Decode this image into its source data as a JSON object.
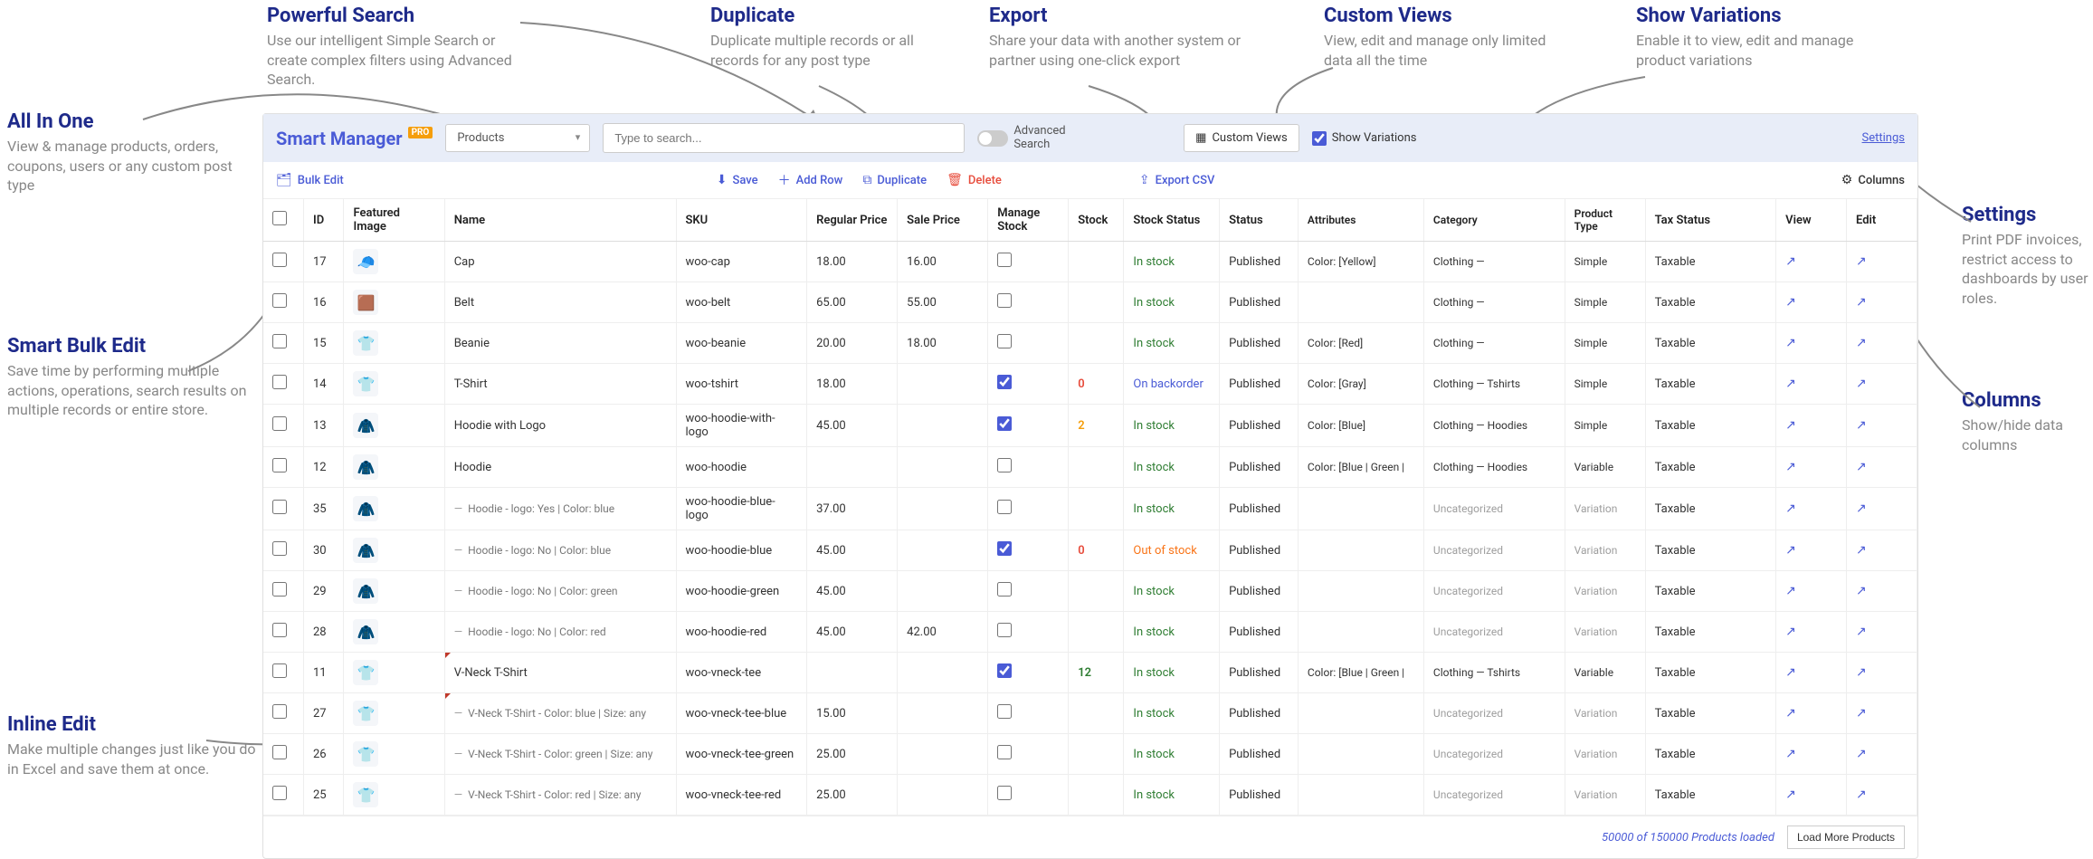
{
  "annotations": {
    "all_in_one": {
      "title": "All In One",
      "desc": "View & manage products, orders, coupons, users or any custom post type"
    },
    "smart_bulk": {
      "title": "Smart Bulk Edit",
      "desc": "Save time by performing multiple actions, operations, search results on multiple records or entire store."
    },
    "inline_edit": {
      "title": "Inline Edit",
      "desc": "Make multiple changes just like you do in Excel and save them at once."
    },
    "powerful_search": {
      "title": "Powerful Search",
      "desc": "Use our intelligent Simple Search or create complex filters using Advanced Search."
    },
    "duplicate": {
      "title": "Duplicate",
      "desc": "Duplicate multiple records or all records for any post type"
    },
    "export": {
      "title": "Export",
      "desc": "Share your data with another system or partner using one-click export"
    },
    "custom_views": {
      "title": "Custom Views",
      "desc": "View, edit and manage only limited data all the time"
    },
    "show_variations": {
      "title": "Show Variations",
      "desc": "Enable it to view, edit and manage product variations"
    },
    "settings": {
      "title": "Settings",
      "desc": "Print PDF invoices, restrict access to dashboards by user roles."
    },
    "columns": {
      "title": "Columns",
      "desc": "Show/hide data columns"
    }
  },
  "brand": {
    "name": "Smart Manager",
    "badge": "PRO"
  },
  "top": {
    "post_type_select": "Products",
    "search_placeholder": "Type to search...",
    "advanced_search": "Advanced Search",
    "custom_views_btn": "Custom Views",
    "show_variations_label": "Show Variations",
    "settings_link": "Settings"
  },
  "toolbar": {
    "bulk_edit": "Bulk Edit",
    "save": "Save",
    "add_row": "Add Row",
    "duplicate": "Duplicate",
    "delete": "Delete",
    "export_csv": "Export CSV",
    "columns_btn": "Columns"
  },
  "columns": [
    "",
    "ID",
    "Featured Image",
    "Name",
    "SKU",
    "Regular Price",
    "Sale Price",
    "Manage Stock",
    "Stock",
    "Stock Status",
    "Status",
    "Attributes",
    "Category",
    "Product Type",
    "Tax Status",
    "View",
    "Edit"
  ],
  "rows": [
    {
      "id": "17",
      "name": "Cap",
      "variation": false,
      "sku": "woo-cap",
      "reg": "18.00",
      "sale": "16.00",
      "ms": false,
      "stock": "",
      "ss": "In stock",
      "status": "Published",
      "attr": "Color: [Yellow]",
      "cat": "Clothing —",
      "ptype": "Simple",
      "tax": "Taxable",
      "emoji": "🧢"
    },
    {
      "id": "16",
      "name": "Belt",
      "variation": false,
      "sku": "woo-belt",
      "reg": "65.00",
      "sale": "55.00",
      "ms": false,
      "stock": "",
      "ss": "In stock",
      "status": "Published",
      "attr": "",
      "cat": "Clothing —",
      "ptype": "Simple",
      "tax": "Taxable",
      "emoji": "🟫"
    },
    {
      "id": "15",
      "name": "Beanie",
      "variation": false,
      "sku": "woo-beanie",
      "reg": "20.00",
      "sale": "18.00",
      "ms": false,
      "stock": "",
      "ss": "In stock",
      "status": "Published",
      "attr": "Color: [Red]",
      "cat": "Clothing —",
      "ptype": "Simple",
      "tax": "Taxable",
      "emoji": "👕"
    },
    {
      "id": "14",
      "name": "T-Shirt",
      "variation": false,
      "sku": "woo-tshirt",
      "reg": "18.00",
      "sale": "",
      "ms": true,
      "stock": "0",
      "stock_cls": "zero",
      "ss": "On backorder",
      "ss_cls": "bo",
      "status": "Published",
      "attr": "Color: [Gray]",
      "cat": "Clothing — Tshirts",
      "ptype": "Simple",
      "tax": "Taxable",
      "emoji": "👕"
    },
    {
      "id": "13",
      "name": "Hoodie with Logo",
      "variation": false,
      "sku": "woo-hoodie-with-logo",
      "reg": "45.00",
      "sale": "",
      "ms": true,
      "stock": "2",
      "stock_cls": "warn",
      "ss": "In stock",
      "status": "Published",
      "attr": "Color: [Blue]",
      "cat": "Clothing — Hoodies",
      "ptype": "Simple",
      "tax": "Taxable",
      "emoji": "🧥"
    },
    {
      "id": "12",
      "name": "Hoodie",
      "variation": false,
      "sku": "woo-hoodie",
      "reg": "",
      "sale": "",
      "ms": false,
      "stock": "",
      "ss": "In stock",
      "status": "Published",
      "attr": "Color: [Blue | Green | ",
      "cat": "Clothing — Hoodies",
      "ptype": "Variable",
      "tax": "Taxable",
      "emoji": "🧥"
    },
    {
      "id": "35",
      "name": "Hoodie - logo: Yes | Color: blue",
      "variation": true,
      "sku": "woo-hoodie-blue-logo",
      "reg": "37.00",
      "sale": "",
      "ms": false,
      "stock": "",
      "ss": "In stock",
      "status": "Published",
      "attr": "",
      "cat": "Uncategorized",
      "cat_uncat": true,
      "ptype": "Variation",
      "ptype_var": true,
      "tax": "Taxable",
      "emoji": "🧥"
    },
    {
      "id": "30",
      "name": "Hoodie - logo: No | Color: blue",
      "variation": true,
      "sku": "woo-hoodie-blue",
      "reg": "45.00",
      "sale": "",
      "ms": true,
      "stock": "0",
      "stock_cls": "zero",
      "ss": "Out of stock",
      "ss_cls": "out",
      "status": "Published",
      "attr": "",
      "cat": "Uncategorized",
      "cat_uncat": true,
      "ptype": "Variation",
      "ptype_var": true,
      "tax": "Taxable",
      "emoji": "🧥"
    },
    {
      "id": "29",
      "name": "Hoodie - logo: No | Color: green",
      "variation": true,
      "sku": "woo-hoodie-green",
      "reg": "45.00",
      "sale": "",
      "ms": false,
      "stock": "",
      "ss": "In stock",
      "status": "Published",
      "attr": "",
      "cat": "Uncategorized",
      "cat_uncat": true,
      "ptype": "Variation",
      "ptype_var": true,
      "tax": "Taxable",
      "emoji": "🧥"
    },
    {
      "id": "28",
      "name": "Hoodie - logo: No | Color: red",
      "variation": true,
      "sku": "woo-hoodie-red",
      "reg": "45.00",
      "sale": "42.00",
      "ms": false,
      "stock": "",
      "ss": "In stock",
      "status": "Published",
      "attr": "",
      "cat": "Uncategorized",
      "cat_uncat": true,
      "ptype": "Variation",
      "ptype_var": true,
      "tax": "Taxable",
      "emoji": "🧥"
    },
    {
      "id": "11",
      "name": "V-Neck T-Shirt",
      "variation": false,
      "edit_mark": true,
      "sku": "woo-vneck-tee",
      "reg": "",
      "sale": "",
      "ms": true,
      "stock": "12",
      "stock_cls": "ok",
      "ss": "In stock",
      "status": "Published",
      "attr": "Color: [Blue | Green | ",
      "cat": "Clothing — Tshirts",
      "ptype": "Variable",
      "tax": "Taxable",
      "emoji": "👕"
    },
    {
      "id": "27",
      "name": "V-Neck T-Shirt - Color: blue | Size: any",
      "variation": true,
      "edit_mark": true,
      "sku": "woo-vneck-tee-blue",
      "reg": "15.00",
      "sale": "",
      "ms": false,
      "stock": "",
      "ss": "In stock",
      "status": "Published",
      "attr": "",
      "cat": "Uncategorized",
      "cat_uncat": true,
      "ptype": "Variation",
      "ptype_var": true,
      "tax": "Taxable",
      "emoji": "👕"
    },
    {
      "id": "26",
      "name": "V-Neck T-Shirt - Color: green | Size: any",
      "variation": true,
      "sku": "woo-vneck-tee-green",
      "reg": "25.00",
      "sale": "",
      "ms": false,
      "stock": "",
      "ss": "In stock",
      "status": "Published",
      "attr": "",
      "cat": "Uncategorized",
      "cat_uncat": true,
      "ptype": "Variation",
      "ptype_var": true,
      "tax": "Taxable",
      "emoji": "👕"
    },
    {
      "id": "25",
      "name": "V-Neck T-Shirt - Color: red | Size: any",
      "variation": true,
      "sku": "woo-vneck-tee-red",
      "reg": "25.00",
      "sale": "",
      "ms": false,
      "stock": "",
      "ss": "In stock",
      "status": "Published",
      "attr": "",
      "cat": "Uncategorized",
      "cat_uncat": true,
      "ptype": "Variation",
      "ptype_var": true,
      "tax": "Taxable",
      "emoji": "👕"
    }
  ],
  "footer": {
    "info": "50000 of 150000 Products loaded",
    "load_more": "Load More Products"
  }
}
